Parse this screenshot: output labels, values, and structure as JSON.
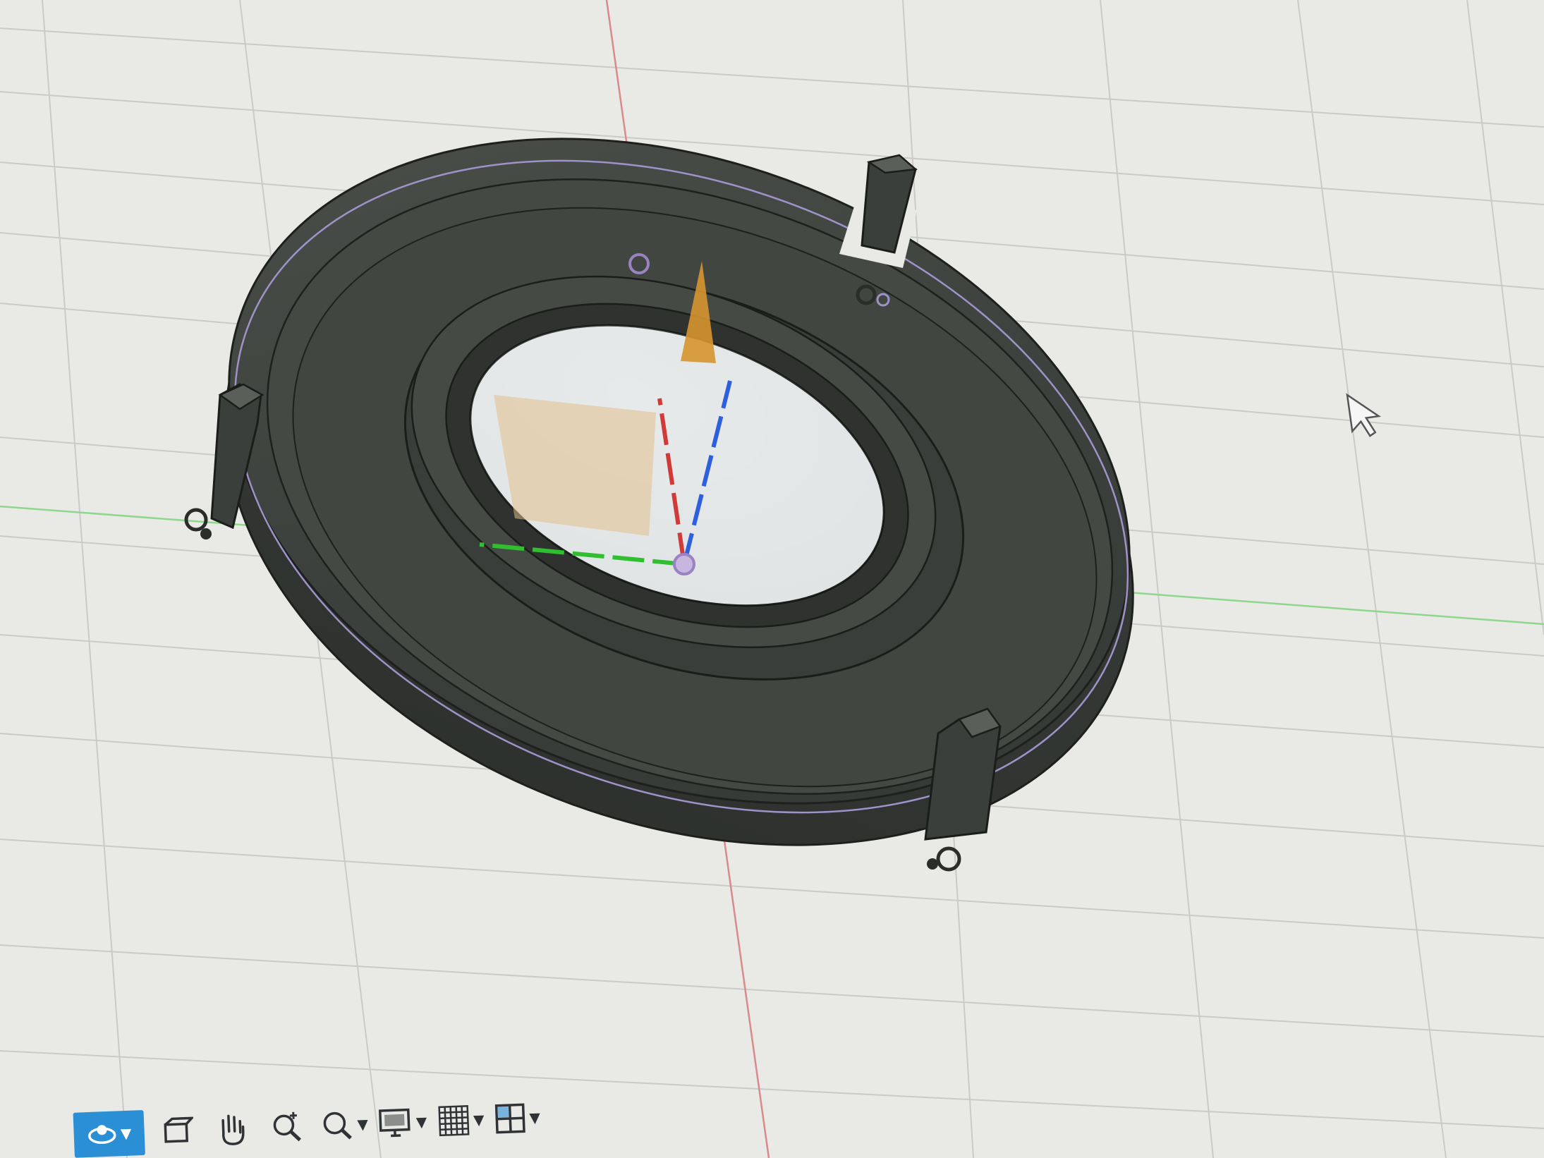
{
  "app": {
    "view": "3D viewport"
  },
  "colors": {
    "canvas": "#e9e9e6",
    "grid": "#c7c7c4",
    "axis_x": "#d23a3a",
    "axis_y": "#2fbf2f",
    "axis_z": "#2e5fe0",
    "body": "#3d413d",
    "body_light": "#4a4f4a",
    "edge": "#1e201e",
    "triad_cone": "#d7952f",
    "toolbar_active": "#2b8fd6"
  },
  "toolbar": {
    "tools": [
      {
        "icon": "orbit-icon",
        "active": true,
        "has_dropdown": true
      },
      {
        "icon": "look-at-icon",
        "active": false,
        "has_dropdown": false
      },
      {
        "icon": "pan-hand-icon",
        "active": false,
        "has_dropdown": false
      },
      {
        "icon": "zoom-icon",
        "active": false,
        "has_dropdown": false
      },
      {
        "icon": "zoom-window-icon",
        "active": false,
        "has_dropdown": true
      },
      {
        "icon": "display-settings-icon",
        "active": false,
        "has_dropdown": true
      },
      {
        "icon": "grid-snap-icon",
        "active": false,
        "has_dropdown": true
      },
      {
        "icon": "viewports-icon",
        "active": false,
        "has_dropdown": true
      }
    ]
  },
  "cursor": {
    "icon": "arrow-cursor-icon"
  }
}
